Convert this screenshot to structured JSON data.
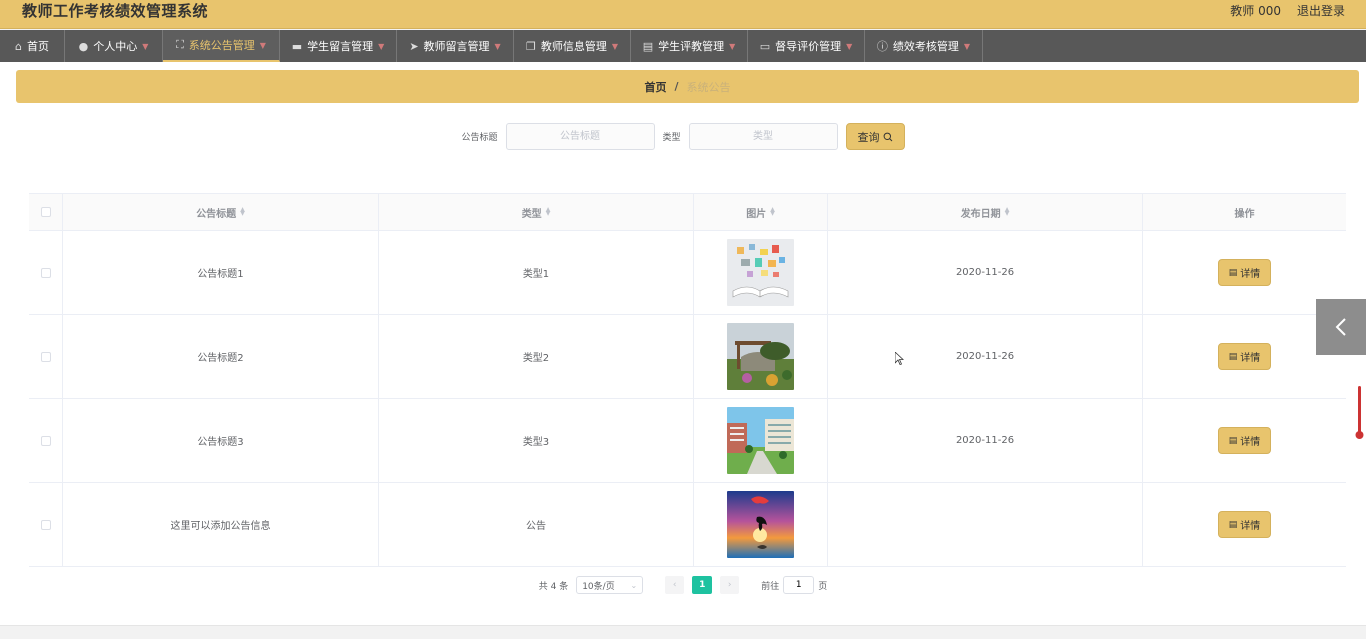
{
  "app": {
    "title": "教师工作考核绩效管理系统"
  },
  "header": {
    "user": "教师 000",
    "logout": "退出登录"
  },
  "nav": [
    {
      "label": "首页",
      "icon": "home-icon",
      "glyph": "⌂",
      "has_caret": false,
      "active": false
    },
    {
      "label": "个人中心",
      "icon": "user-icon",
      "glyph": "●",
      "has_caret": true,
      "active": false
    },
    {
      "label": "系统公告管理",
      "icon": "fullscreen-icon",
      "glyph": "⛶",
      "has_caret": true,
      "active": true
    },
    {
      "label": "学生留言管理",
      "icon": "briefcase-icon",
      "glyph": "▬",
      "has_caret": true,
      "active": false
    },
    {
      "label": "教师留言管理",
      "icon": "send-icon",
      "glyph": "➤",
      "has_caret": true,
      "active": false
    },
    {
      "label": "教师信息管理",
      "icon": "copy-icon",
      "glyph": "❐",
      "has_caret": true,
      "active": false
    },
    {
      "label": "学生评教管理",
      "icon": "document-icon",
      "glyph": "▤",
      "has_caret": true,
      "active": false
    },
    {
      "label": "督导评价管理",
      "icon": "monitor-icon",
      "glyph": "▭",
      "has_caret": true,
      "active": false
    },
    {
      "label": "绩效考核管理",
      "icon": "info-icon",
      "glyph": "ⓘ",
      "has_caret": true,
      "active": false
    }
  ],
  "breadcrumb": {
    "home": "首页",
    "separator": "/",
    "current": "系统公告"
  },
  "search": {
    "title_label": "公告标题",
    "title_placeholder": "公告标题",
    "type_label": "类型",
    "type_placeholder": "类型",
    "button": "查询"
  },
  "table": {
    "headers": {
      "title": "公告标题",
      "type": "类型",
      "image": "图片",
      "date": "发布日期",
      "action": "操作"
    },
    "rows": [
      {
        "title": "公告标题1",
        "type": "类型1",
        "image": "book-image",
        "date": "2020-11-26",
        "action": "详情"
      },
      {
        "title": "公告标题2",
        "type": "类型2",
        "image": "garden-image",
        "date": "2020-11-26",
        "action": "详情"
      },
      {
        "title": "公告标题3",
        "type": "类型3",
        "image": "campus-image",
        "date": "2020-11-26",
        "action": "详情"
      },
      {
        "title": "这里可以添加公告信息",
        "type": "公告",
        "image": "dolphin-sunset-image",
        "date": "",
        "action": "详情"
      }
    ]
  },
  "pagination": {
    "total": "共 4 条",
    "page_size": "10条/页",
    "current_page": "1",
    "goto_label": "前往",
    "goto_value": "1",
    "page_suffix": "页"
  },
  "colors": {
    "accent": "#e8c46d",
    "nav_bg": "#585858",
    "page_active": "#1ec2a0"
  }
}
